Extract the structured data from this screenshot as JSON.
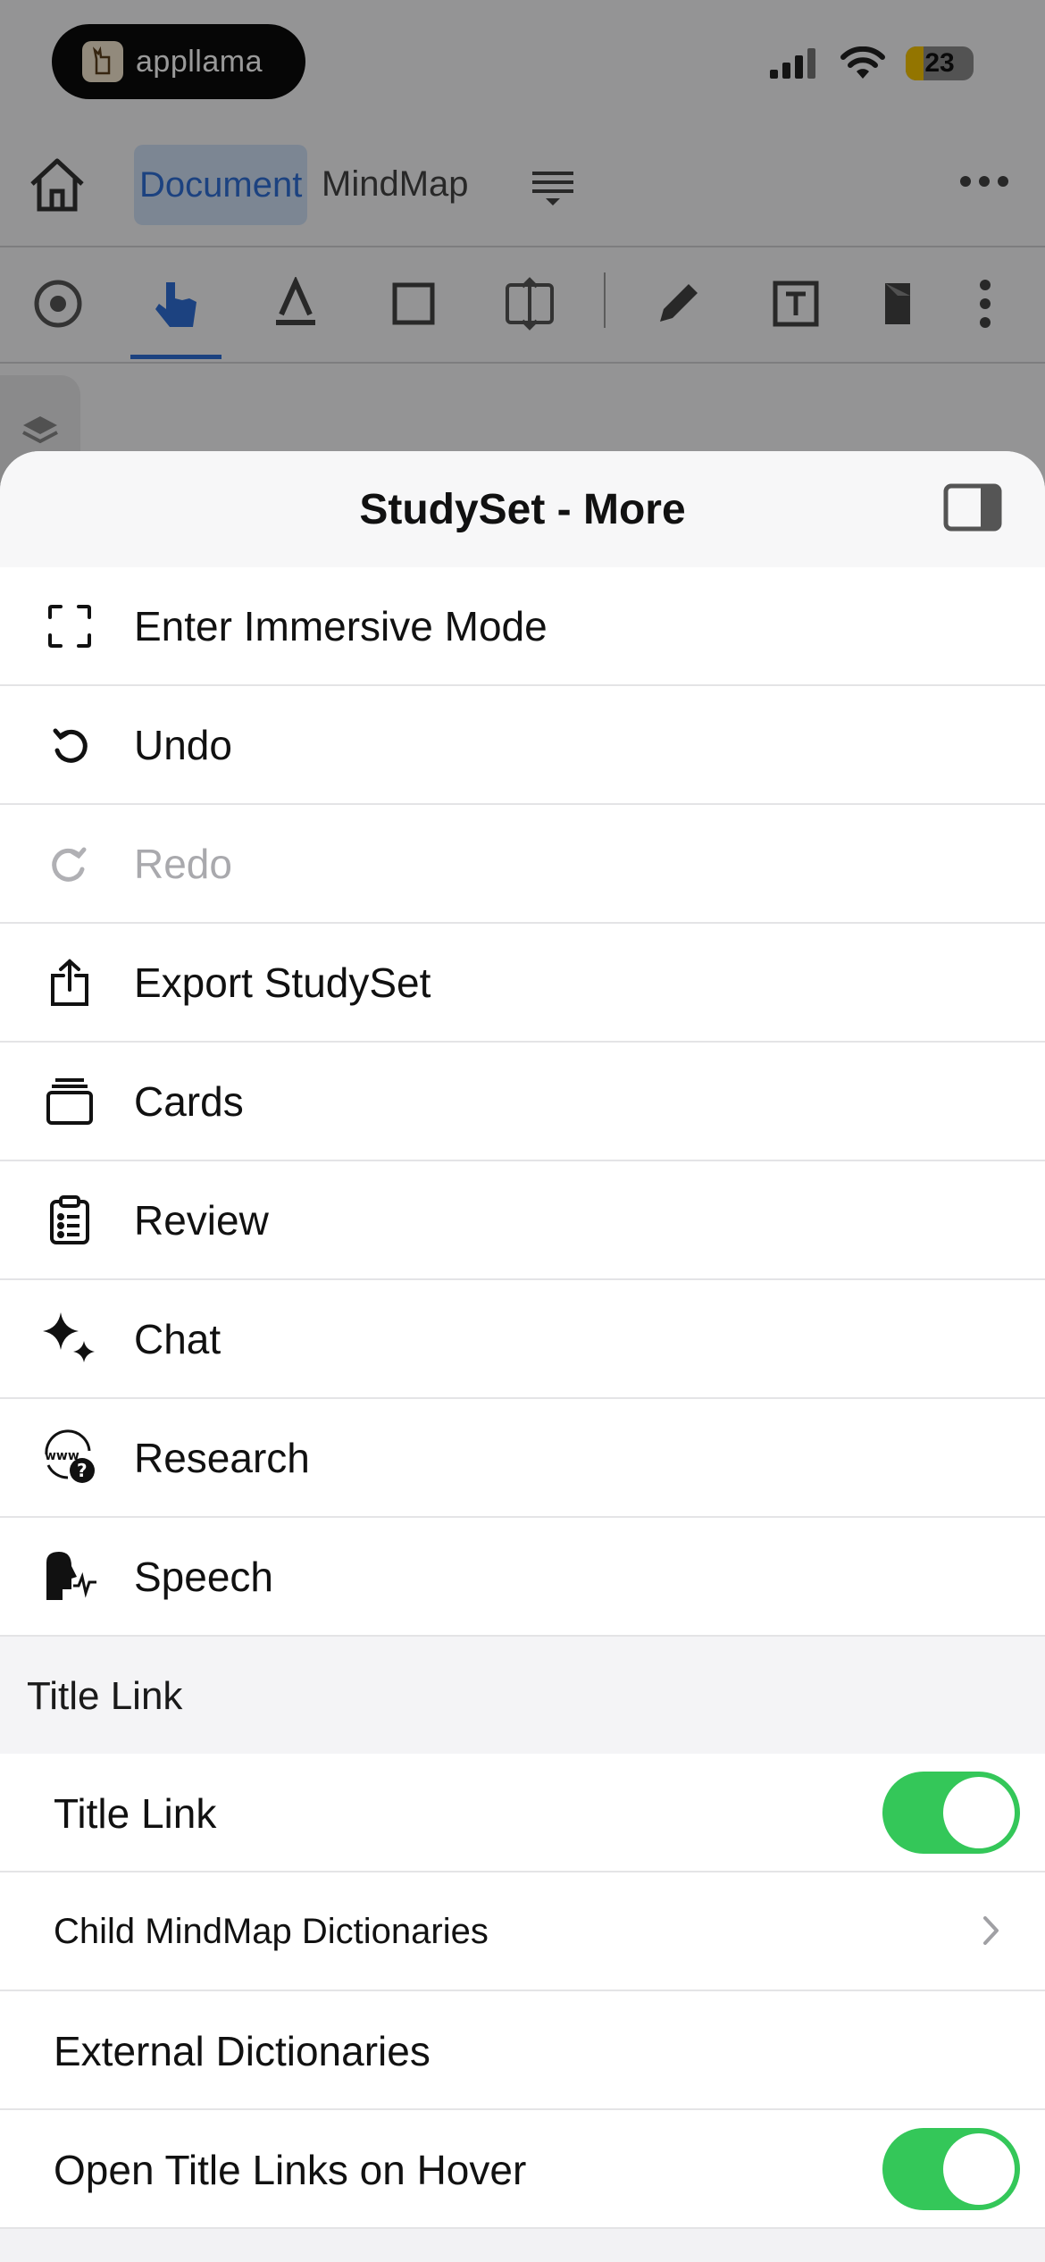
{
  "status_bar": {
    "app_badge": "appllama",
    "battery_level": "23"
  },
  "nav": {
    "tab_document": "Document",
    "tab_mindmap": "MindMap"
  },
  "sheet": {
    "title": "StudySet - More",
    "menu": [
      {
        "label": "Enter Immersive Mode",
        "icon": "fullscreen-icon",
        "enabled": true
      },
      {
        "label": "Undo",
        "icon": "undo-icon",
        "enabled": true
      },
      {
        "label": "Redo",
        "icon": "redo-icon",
        "enabled": false
      },
      {
        "label": "Export StudySet",
        "icon": "share-icon",
        "enabled": true
      },
      {
        "label": "Cards",
        "icon": "cards-icon",
        "enabled": true
      },
      {
        "label": "Review",
        "icon": "clipboard-list-icon",
        "enabled": true
      },
      {
        "label": "Chat",
        "icon": "sparkles-icon",
        "enabled": true
      },
      {
        "label": "Research",
        "icon": "web-question-icon",
        "enabled": true
      },
      {
        "label": "Speech",
        "icon": "speech-icon",
        "enabled": true
      }
    ],
    "section_title": "Title Link",
    "settings": [
      {
        "label": "Title Link",
        "type": "toggle",
        "on": true
      },
      {
        "label": "Child MindMap Dictionaries",
        "type": "disclosure"
      },
      {
        "label": "External Dictionaries",
        "type": "plain"
      },
      {
        "label": "Open Title Links on Hover",
        "type": "toggle",
        "on": true
      }
    ]
  },
  "colors": {
    "accent": "#2f6fd6",
    "toggle_on": "#34c759"
  }
}
